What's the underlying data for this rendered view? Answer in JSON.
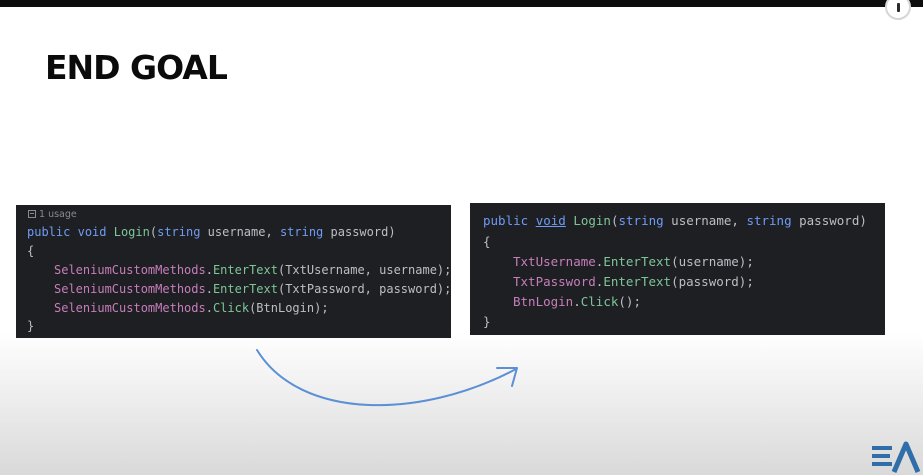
{
  "slide": {
    "title": "END GOAL"
  },
  "left_code": {
    "usage_hint": "1 usage",
    "line1": {
      "kw1": "public",
      "kw2": "void",
      "fn": "Login",
      "p1": "(",
      "t1": "string",
      "p2": " username, ",
      "t2": "string",
      "p3": " password)"
    },
    "brace_open": "{",
    "line3": {
      "cls": "SeleniumCustomMethods",
      "dot": ".",
      "method": "EnterText",
      "args": "(TxtUsername, username);"
    },
    "line4": {
      "cls": "SeleniumCustomMethods",
      "dot": ".",
      "method": "EnterText",
      "args": "(TxtPassword, password);"
    },
    "line5": {
      "cls": "SeleniumCustomMethods",
      "dot": ".",
      "method": "Click",
      "args": "(BtnLogin);"
    },
    "brace_close": "}"
  },
  "right_code": {
    "line1": {
      "kw1": "public",
      "kw2": "void",
      "fn": "Login",
      "p1": "(",
      "t1": "string",
      "p2": " username, ",
      "t2": "string",
      "p3": " password)"
    },
    "brace_open": "{",
    "line3": {
      "prop": "TxtUsername",
      "dot": ".",
      "method": "EnterText",
      "args": "(username);"
    },
    "line4": {
      "prop": "TxtPassword",
      "dot": ".",
      "method": "EnterText",
      "args": "(password);"
    },
    "line5": {
      "prop": "BtnLogin",
      "dot": ".",
      "method": "Click",
      "args": "();"
    },
    "brace_close": "}"
  },
  "colors": {
    "code_background": "#1e1f22",
    "arrow": "#5b8fd6",
    "logo": "#2f6ea8"
  },
  "icons": {
    "info": "info-icon",
    "usage": "document-icon",
    "logo": "ea-logo"
  }
}
